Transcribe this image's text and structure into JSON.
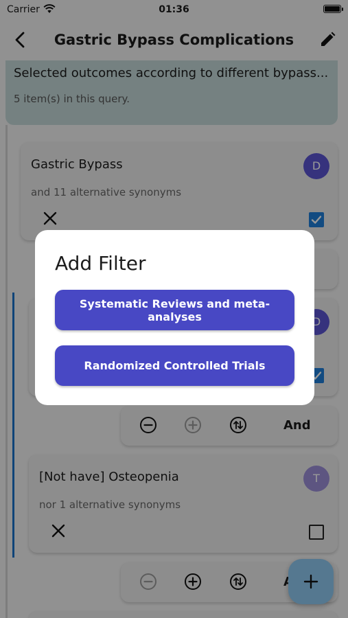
{
  "status_bar": {
    "carrier": "Carrier",
    "time": "01:36"
  },
  "nav": {
    "title": "Gastric Bypass Complications"
  },
  "query": {
    "description": "Selected outcomes according to different bypass...",
    "count_text": "5 item(s) in this query."
  },
  "terms": [
    {
      "name": "Gastric Bypass",
      "synonyms": "and 11 alternative synonyms",
      "avatar": "D",
      "avatar_color": "#5a54d0",
      "checked": true
    },
    {
      "name": "",
      "synonyms": "",
      "avatar": "D",
      "avatar_color": "#5a54d0",
      "checked": true
    },
    {
      "name": "[Not have] Osteopenia",
      "synonyms": "nor 1 alternative synonyms",
      "avatar": "T",
      "avatar_color": "#9b8ed8",
      "checked": false
    }
  ],
  "operators": [
    {
      "and_label": "And"
    },
    {
      "and_label": "And"
    }
  ],
  "dialog": {
    "title": "Add Filter",
    "options": [
      "Systematic Reviews and meta-analyses",
      "Randomized Controlled Trials"
    ]
  },
  "colors": {
    "accent": "#4848c4",
    "checkbox": "#1e7ed8",
    "fab": "#8ec8f0",
    "query_card": "#c4d8d8"
  }
}
